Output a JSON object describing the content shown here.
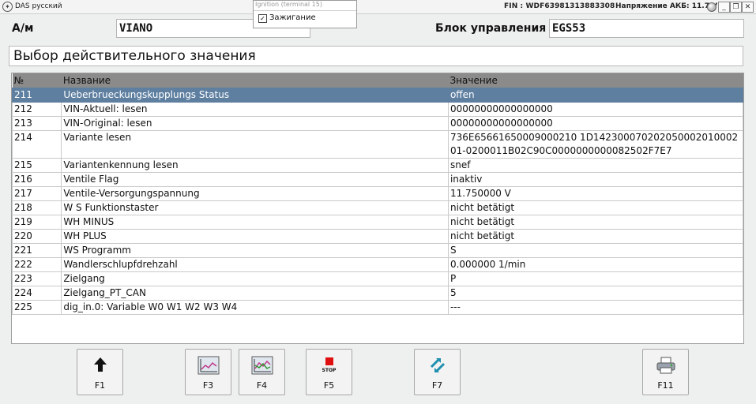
{
  "window": {
    "title": "DAS русский",
    "fin": "FIN : WDF63981313883308",
    "battery_voltage": "Напряжение АКБ: 11.7 V",
    "minimize_label": "_",
    "restore_label": "❐",
    "close_label": "✕"
  },
  "dropdown": {
    "top_item": "Ignition (terminal 15)",
    "checkbox_label": "Зажигание",
    "checked": true
  },
  "header": {
    "model_label": "А/м",
    "model_value": "VIANO",
    "control_unit_label": "Блок управления",
    "control_unit_value": "EGS53"
  },
  "page_title": "Выбор действительного значения",
  "table": {
    "columns": [
      "№",
      "Название",
      "Значение"
    ],
    "rows": [
      {
        "no": "211",
        "name": "Ueberbrueckungskupplungs Status",
        "value": "offen",
        "selected": true
      },
      {
        "no": "212",
        "name": "VIN-Aktuell: lesen",
        "value": "00000000000000000"
      },
      {
        "no": "213",
        "name": "VIN-Original: lesen",
        "value": "00000000000000000"
      },
      {
        "no": "214",
        "name": "Variante lesen",
        "value": "736E65661650009000210 1D14230007020205000201000201-0200011B02C90C0000000000082502F7E7"
      },
      {
        "no": "215",
        "name": "Variantenkennung lesen",
        "value": "snef"
      },
      {
        "no": "216",
        "name": "Ventile Flag",
        "value": "inaktiv"
      },
      {
        "no": "217",
        "name": "Ventile-Versorgungspannung",
        "value": "11.750000 V"
      },
      {
        "no": "218",
        "name": "W S Funktionstaster",
        "value": "nicht betätigt"
      },
      {
        "no": "219",
        "name": "WH MINUS",
        "value": "nicht betätigt"
      },
      {
        "no": "220",
        "name": "WH PLUS",
        "value": "nicht betätigt"
      },
      {
        "no": "221",
        "name": "WS Programm",
        "value": "S"
      },
      {
        "no": "222",
        "name": "Wandlerschlupfdrehzahl",
        "value": "0.000000 1/min"
      },
      {
        "no": "223",
        "name": "Zielgang",
        "value": "P"
      },
      {
        "no": "224",
        "name": "Zielgang_PT_CAN",
        "value": "5"
      },
      {
        "no": "225",
        "name": "dig_in.0: Variable W0 W1 W2 W3 W4",
        "value": "---"
      }
    ]
  },
  "buttons": [
    {
      "key": "F1",
      "icon": "arrow-up-icon"
    },
    {
      "key": "F3",
      "icon": "graph-icon"
    },
    {
      "key": "F4",
      "icon": "multi-graph-icon"
    },
    {
      "key": "F5",
      "icon": "stop-icon",
      "icon_text": "STOP"
    },
    {
      "key": "F7",
      "icon": "swap-arrows-icon"
    },
    {
      "key": "F11",
      "icon": "printer-icon"
    }
  ],
  "colors": {
    "selected_row": "#5e7fa0",
    "header_row": "#8b8b8b",
    "stop_red": "#e01010"
  }
}
